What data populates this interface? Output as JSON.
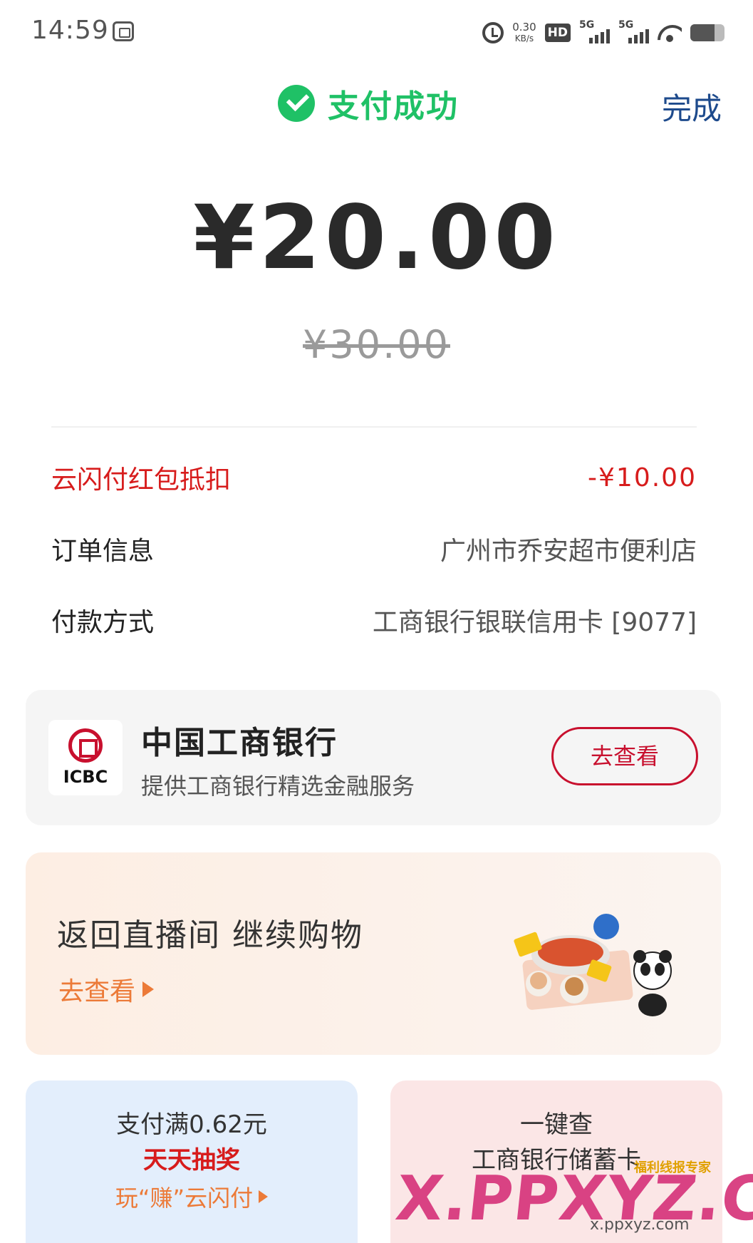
{
  "status_bar": {
    "time": "14:59",
    "net_speed_value": "0.30",
    "net_speed_unit": "KB/s",
    "hd_label": "HD",
    "signal_label": "5G",
    "battery_level": 0.7
  },
  "header": {
    "title": "支付成功",
    "done_label": "完成",
    "accent_color": "#1fc166"
  },
  "payment": {
    "amount": "¥20.00",
    "original_amount": "¥30.00"
  },
  "details": [
    {
      "label": "云闪付红包抵扣",
      "value": "-¥10.00"
    },
    {
      "label": "订单信息",
      "value": "广州市乔安超市便利店"
    },
    {
      "label": "付款方式",
      "value": "工商银行银联信用卡 [9077]"
    }
  ],
  "bank_card": {
    "logo_text": "ICBC",
    "name": "中国工商银行",
    "description": "提供工商银行精选金融服务",
    "button_label": "去查看"
  },
  "promo_card": {
    "title": "返回直播间  继续购物",
    "link_label": "去查看"
  },
  "mini_cards": {
    "left": {
      "line1": "支付满0.62元",
      "line2": "天天抽奖",
      "line3": "玩“赚”云闪付"
    },
    "right": {
      "line1": "一键查",
      "line2": "工商银行储蓄卡"
    }
  },
  "watermark": {
    "brand": "X.PPXYZ.COM",
    "url": "x.ppxyz.com",
    "tag": "福利线报专家"
  }
}
